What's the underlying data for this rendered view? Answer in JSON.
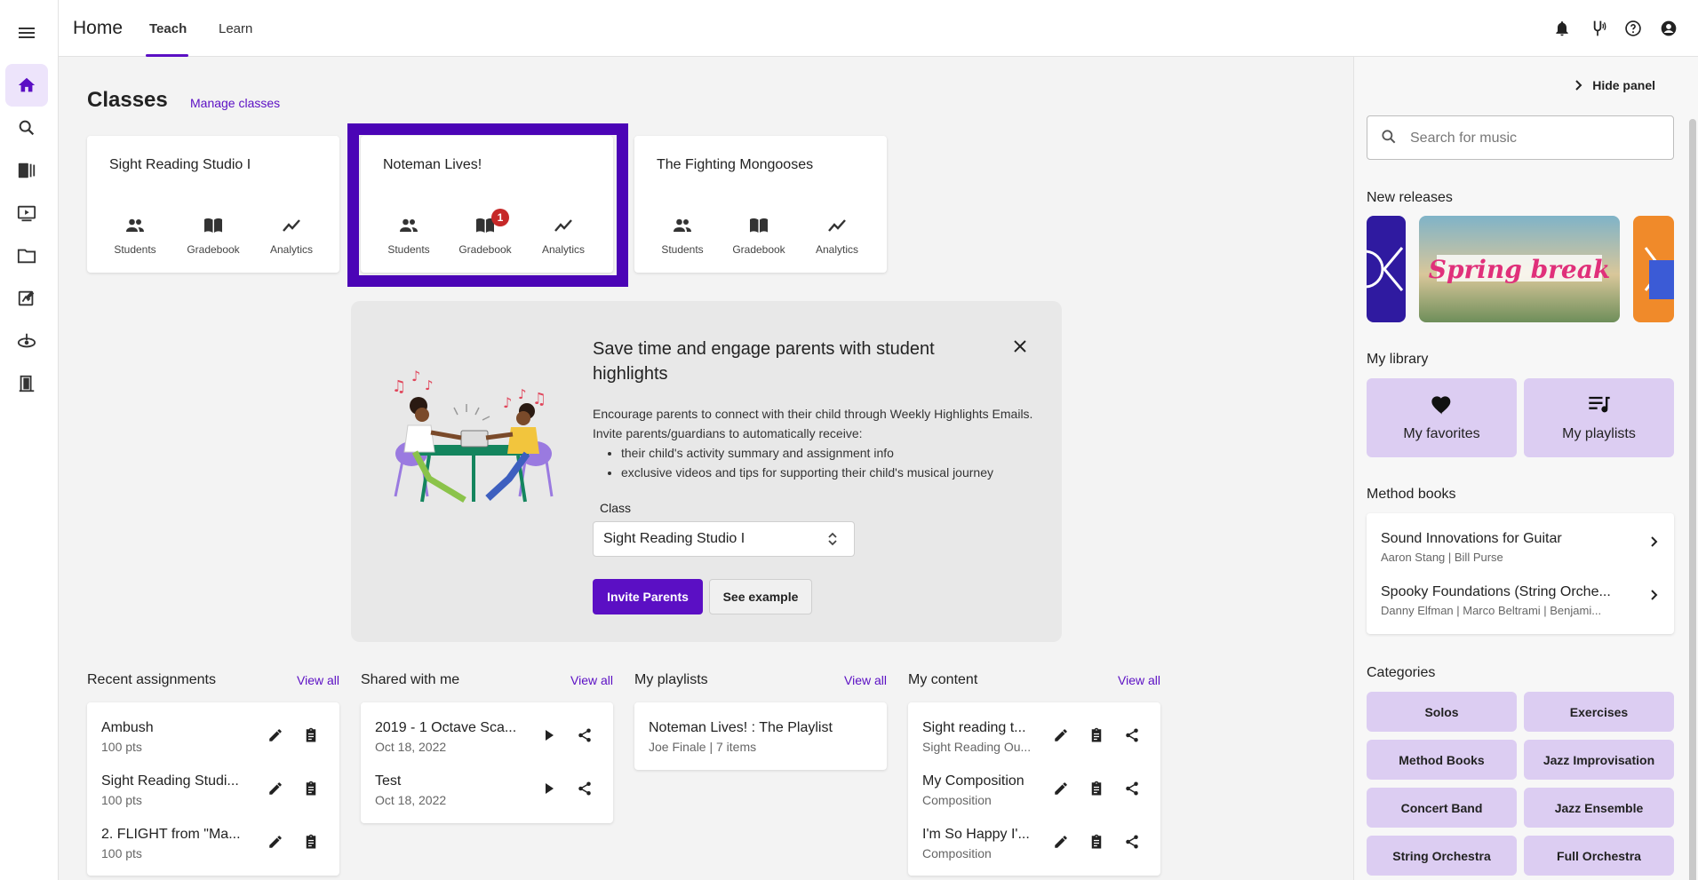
{
  "app": {
    "title": "Home",
    "tabs": [
      {
        "label": "Teach",
        "active": true
      },
      {
        "label": "Learn",
        "active": false
      }
    ],
    "accent_color": "#5b0fc4"
  },
  "rail": {
    "items": [
      {
        "icon": "home-icon",
        "active": true
      },
      {
        "icon": "search-icon"
      },
      {
        "icon": "library-icon"
      },
      {
        "icon": "video-icon"
      },
      {
        "icon": "folder-icon"
      },
      {
        "icon": "assignment-icon"
      },
      {
        "icon": "tuner-icon"
      },
      {
        "icon": "door-icon"
      }
    ]
  },
  "topbar_icons": [
    "bell-icon",
    "tuning-fork-icon",
    "help-icon",
    "account-icon"
  ],
  "classes": {
    "heading": "Classes",
    "manage_link": "Manage classes",
    "cards": [
      {
        "name": "Sight Reading Studio I",
        "students": "Students",
        "gradebook": "Gradebook",
        "analytics": "Analytics",
        "badge": ""
      },
      {
        "name": "Noteman Lives!",
        "students": "Students",
        "gradebook": "Gradebook",
        "analytics": "Analytics",
        "badge": "1"
      },
      {
        "name": "The Fighting Mongooses",
        "students": "Students",
        "gradebook": "Gradebook",
        "analytics": "Analytics",
        "badge": ""
      }
    ]
  },
  "promo": {
    "title": "Save time and engage parents with student highlights",
    "body": "Encourage parents to connect with their child through Weekly Highlights Emails. Invite parents/guardians to automatically receive:",
    "bullets": [
      "their child's activity summary and assignment info",
      "exclusive videos and tips for supporting their child's musical journey"
    ],
    "class_label": "Class",
    "class_value": "Sight Reading Studio I",
    "invite_button": "Invite Parents",
    "example_button": "See example"
  },
  "sections": {
    "view_all": "View all",
    "recent_assignments": {
      "title": "Recent assignments",
      "items": [
        {
          "main": "Ambush",
          "sub": "100 pts"
        },
        {
          "main": "Sight Reading Studi...",
          "sub": "100 pts"
        },
        {
          "main": "2. FLIGHT from \"Ma...",
          "sub": "100 pts"
        }
      ]
    },
    "shared_with_me": {
      "title": "Shared with me",
      "items": [
        {
          "main": "2019 - 1 Octave Sca...",
          "sub": "Oct 18, 2022"
        },
        {
          "main": "Test",
          "sub": "Oct 18, 2022"
        }
      ]
    },
    "my_playlists": {
      "title": "My playlists",
      "items": [
        {
          "main": "Noteman Lives! : The Playlist",
          "sub": "Joe Finale | 7 items"
        }
      ]
    },
    "my_content": {
      "title": "My content",
      "items": [
        {
          "main": "Sight reading t...",
          "sub": "Sight Reading Ou..."
        },
        {
          "main": "My Composition",
          "sub": "Composition"
        },
        {
          "main": "I'm So Happy I'...",
          "sub": "Composition"
        }
      ]
    }
  },
  "panel": {
    "hide_label": "Hide panel",
    "search_placeholder": "Search for music",
    "new_releases": "New releases",
    "release_text": "Spring break",
    "my_library": "My library",
    "library_tiles": [
      {
        "label": "My favorites",
        "icon": "heart-icon"
      },
      {
        "label": "My playlists",
        "icon": "playlist-icon"
      }
    ],
    "method_books_heading": "Method books",
    "method_books": [
      {
        "title": "Sound Innovations for Guitar",
        "authors": "Aaron Stang | Bill Purse"
      },
      {
        "title": "Spooky Foundations (String Orche...",
        "authors": "Danny Elfman | Marco Beltrami | Benjami..."
      }
    ],
    "categories_heading": "Categories",
    "categories": [
      "Solos",
      "Exercises",
      "Method Books",
      "Jazz Improvisation",
      "Concert Band",
      "Jazz Ensemble",
      "String Orchestra",
      "Full Orchestra"
    ]
  }
}
